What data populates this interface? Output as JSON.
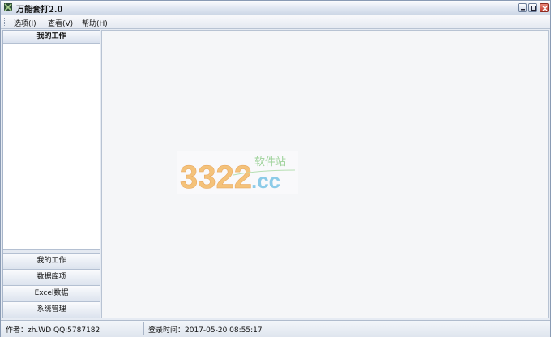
{
  "window": {
    "title": "万能套打2.0",
    "icon": "app-icon",
    "controls": [
      "minimize-icon",
      "maximize-icon",
      "close-icon"
    ]
  },
  "menubar": {
    "items": [
      {
        "label": "选项(I)"
      },
      {
        "label": "查看(V)"
      },
      {
        "label": "帮助(H)"
      }
    ]
  },
  "sidebar": {
    "header": "我的工作",
    "nav": [
      {
        "label": "我的工作"
      },
      {
        "label": "数据库项"
      },
      {
        "label": "Excel数据"
      },
      {
        "label": "系统管理"
      }
    ]
  },
  "watermark": {
    "number": "3322",
    "domain": ".cc",
    "tagline": "软件站"
  },
  "statusbar": {
    "author": "作者：zh.WD   QQ:5787182",
    "login": "登录时间：2017-05-20 08:55:17"
  },
  "colors": {
    "titlebar": "#dfe6f1",
    "panel_border": "#a8b6ca",
    "close_button": "#c0392b"
  }
}
